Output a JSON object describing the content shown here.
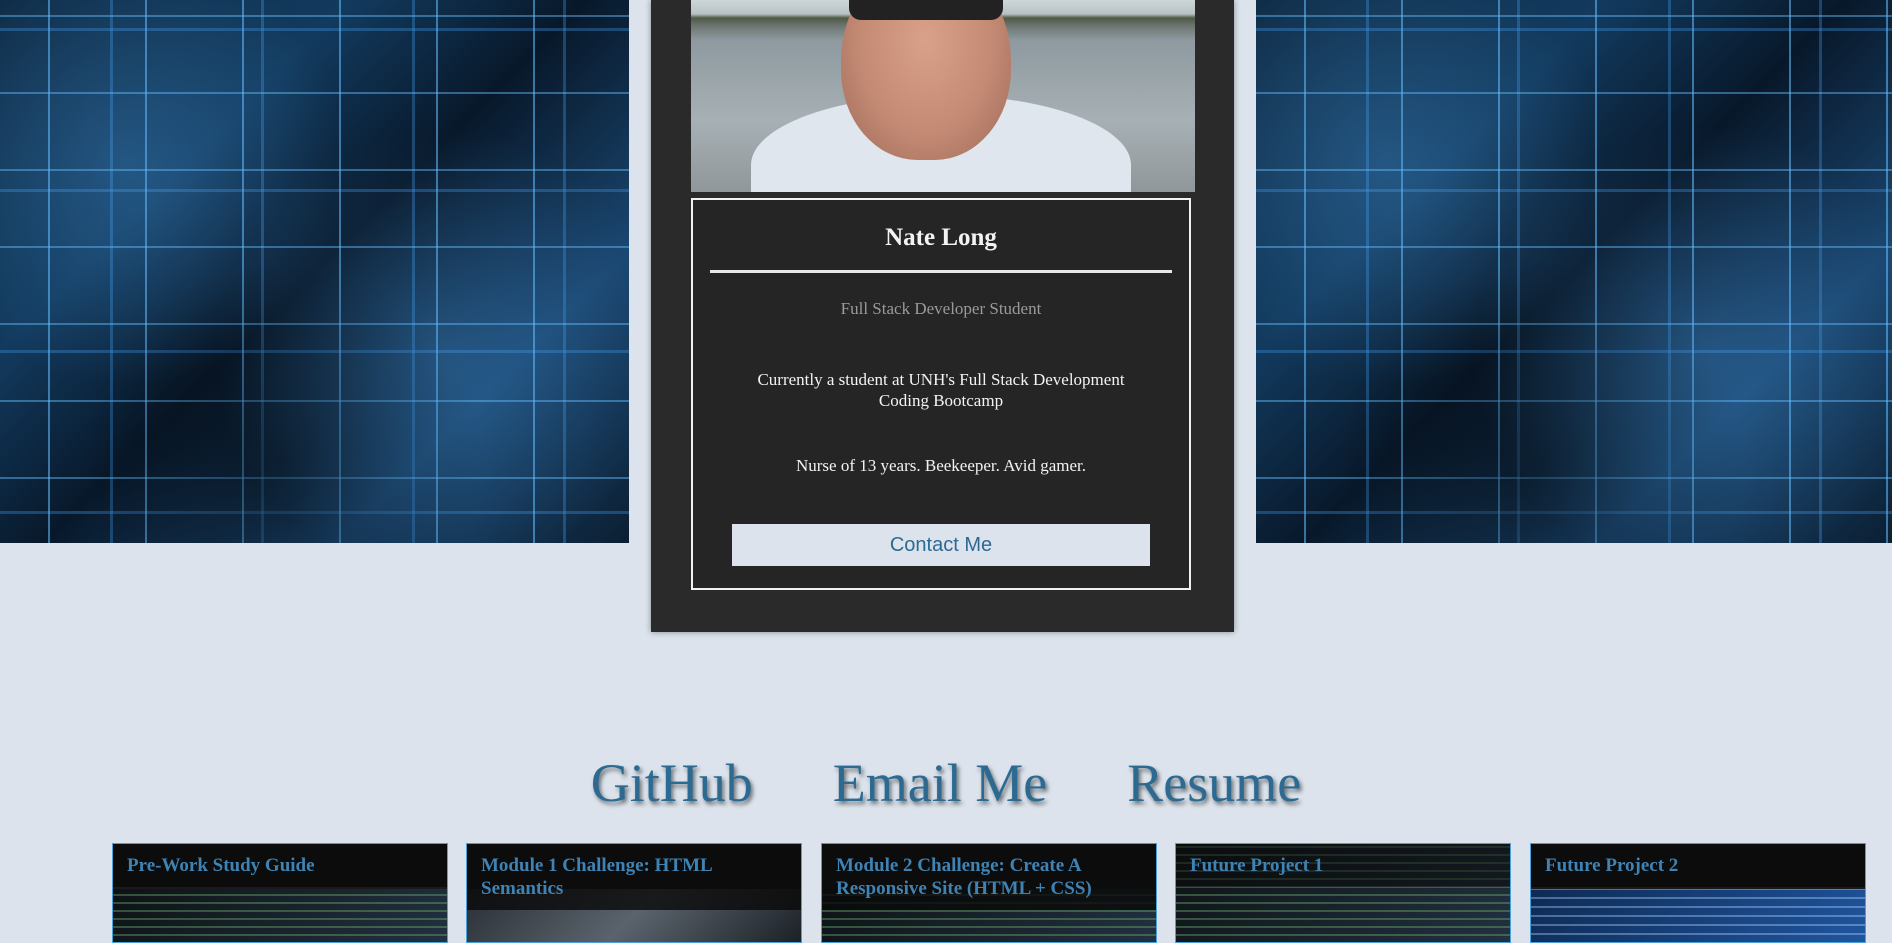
{
  "profile": {
    "name": "Nate Long",
    "role": "Full Stack Developer Student",
    "about": "Currently a student at UNH's Full Stack Development Coding Bootcamp",
    "hobbies": "Nurse of 13 years. Beekeeper. Avid gamer.",
    "contact_label": "Contact Me"
  },
  "links": [
    {
      "label": "GitHub"
    },
    {
      "label": "Email Me"
    },
    {
      "label": "Resume"
    }
  ],
  "projects": [
    {
      "title": "Pre-Work Study Guide"
    },
    {
      "title": "Module 1 Challenge: HTML Semantics"
    },
    {
      "title": "Module 2 Challenge: Create A Responsive Site (HTML + CSS)"
    },
    {
      "title": "Future Project 1"
    },
    {
      "title": "Future Project 2"
    }
  ],
  "colors": {
    "page_bg": "#dce3ec",
    "card_bg": "#2a2a2a",
    "accent": "#2c6a92"
  }
}
